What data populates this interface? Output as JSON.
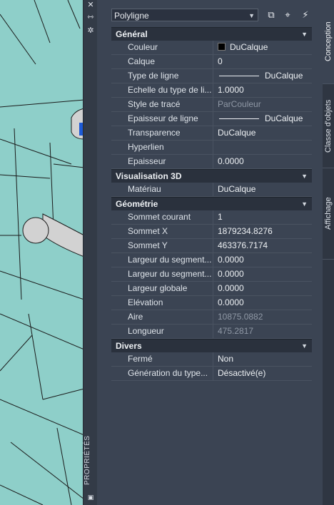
{
  "palette": {
    "title": "PROPRIÉTÉS",
    "close_icon": "close-icon",
    "autohide_icon": "autohide-icon",
    "settings_icon": "gear-icon"
  },
  "selector": {
    "value": "Polyligne",
    "buttons": [
      "toggle-pickadd-icon",
      "select-objects-icon",
      "quick-select-icon"
    ]
  },
  "categories": [
    {
      "title": "Général",
      "rows": [
        {
          "name": "Couleur",
          "value": "DuCalque"
        },
        {
          "name": "Calque",
          "value": "0"
        },
        {
          "name": "Type de ligne",
          "value": "DuCalque"
        },
        {
          "name": "Echelle du type de li...",
          "value": "1.0000"
        },
        {
          "name": "Style de tracé",
          "value": "ParCouleur"
        },
        {
          "name": "Epaisseur de ligne",
          "value": "DuCalque"
        },
        {
          "name": "Transparence",
          "value": "DuCalque"
        },
        {
          "name": "Hyperlien",
          "value": ""
        },
        {
          "name": "Epaisseur",
          "value": "0.0000"
        }
      ]
    },
    {
      "title": "Visualisation 3D",
      "rows": [
        {
          "name": "Matériau",
          "value": "DuCalque"
        }
      ]
    },
    {
      "title": "Géométrie",
      "rows": [
        {
          "name": "Sommet courant",
          "value": "1"
        },
        {
          "name": "Sommet X",
          "value": "1879234.8276"
        },
        {
          "name": "Sommet Y",
          "value": "463376.7174"
        },
        {
          "name": "Largeur du segment...",
          "value": "0.0000"
        },
        {
          "name": "Largeur du segment...",
          "value": "0.0000"
        },
        {
          "name": "Largeur globale",
          "value": "0.0000"
        },
        {
          "name": "Elévation",
          "value": "0.0000"
        },
        {
          "name": "Aire",
          "value": "10875.0882"
        },
        {
          "name": "Longueur",
          "value": "475.2817"
        }
      ]
    },
    {
      "title": "Divers",
      "rows": [
        {
          "name": "Fermé",
          "value": "Non"
        },
        {
          "name": "Génération du type...",
          "value": "Désactivé(e)"
        }
      ]
    }
  ],
  "tabs": [
    "Conception",
    "Classe d'objets",
    "Affichage"
  ]
}
